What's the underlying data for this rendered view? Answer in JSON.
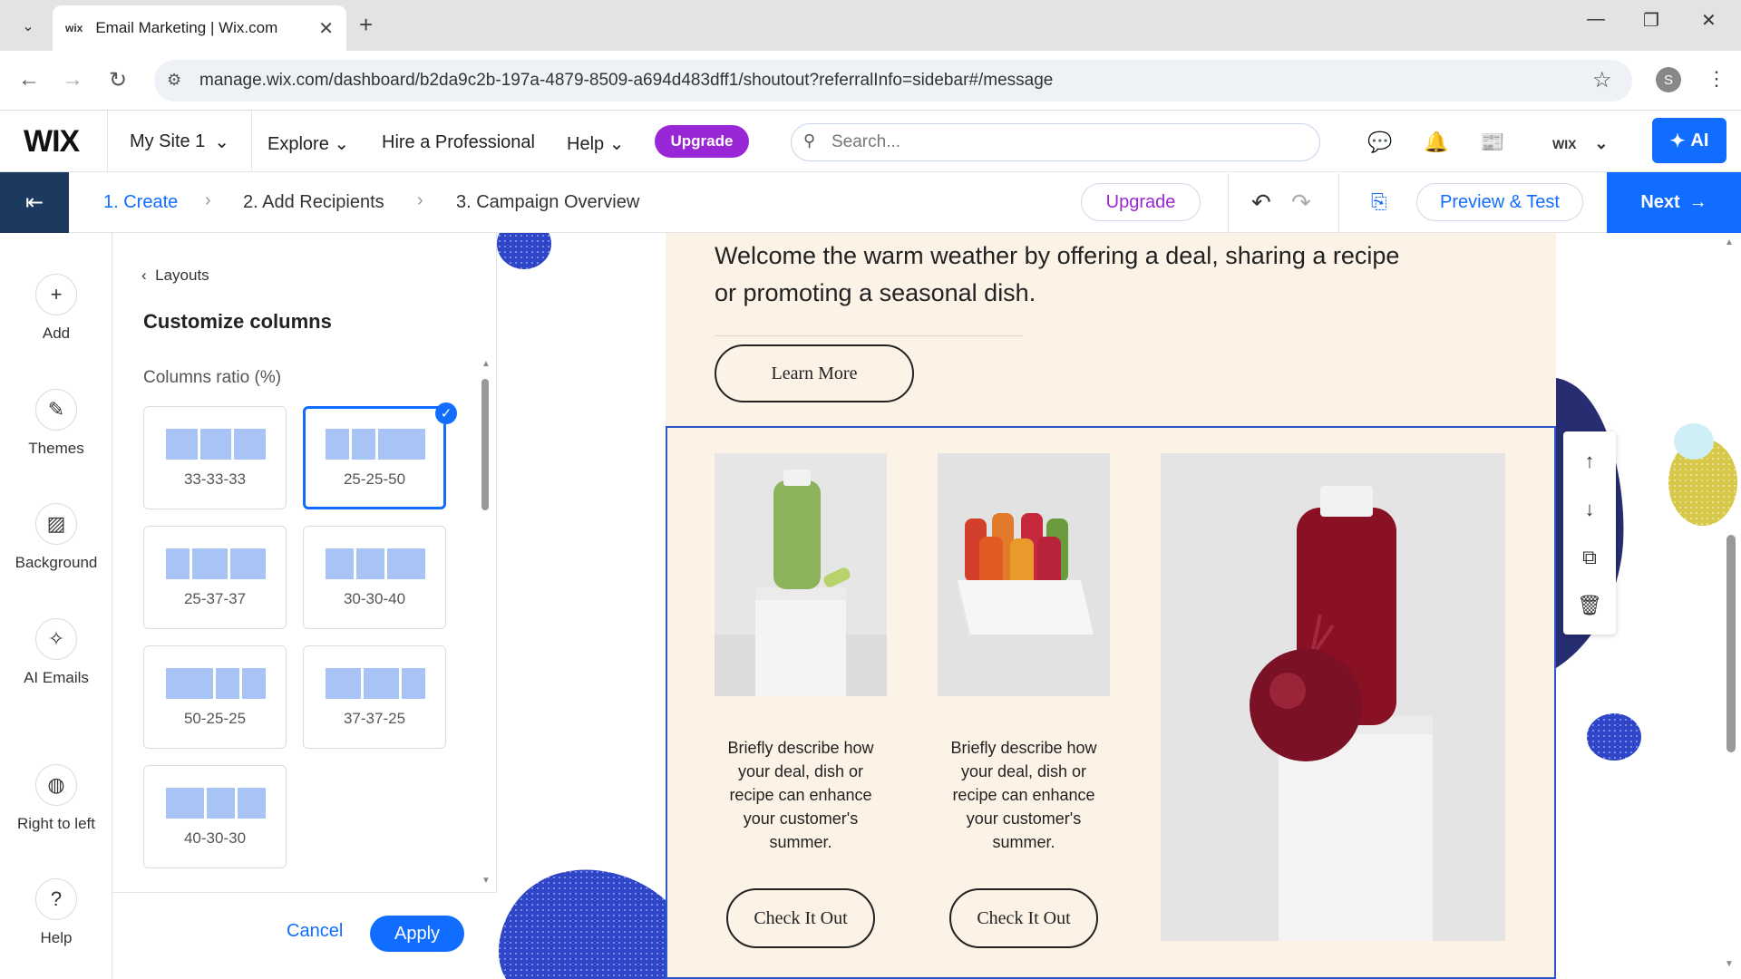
{
  "browser": {
    "tab_title": "Email Marketing | Wix.com",
    "favicon": "wix",
    "url": "manage.wix.com/dashboard/b2da9c2b-197a-4879-8509-a694d483dff1/shoutout?referralInfo=sidebar#/message",
    "profile_initial": "S"
  },
  "topbar": {
    "logo": "WIX",
    "site": "My Site 1",
    "nav": [
      "Explore",
      "Hire a Professional",
      "Help"
    ],
    "upgrade": "Upgrade",
    "search_placeholder": "Search...",
    "account_label": "WIX",
    "ai": "AI"
  },
  "wizard": {
    "steps": [
      "1. Create",
      "2. Add Recipients",
      "3. Campaign Overview"
    ],
    "upgrade": "Upgrade",
    "preview": "Preview & Test",
    "next": "Next"
  },
  "rail": [
    {
      "label": "Add",
      "icon": "plus-icon"
    },
    {
      "label": "Themes",
      "icon": "brush-icon"
    },
    {
      "label": "Background",
      "icon": "background-icon"
    },
    {
      "label": "AI Emails",
      "icon": "sparkle-icon"
    },
    {
      "label": "Right to left",
      "icon": "globe-icon"
    },
    {
      "label": "Help",
      "icon": "help-icon"
    }
  ],
  "panel": {
    "back": "Layouts",
    "title": "Customize columns",
    "ratio_label": "Columns ratio (%)",
    "options": [
      {
        "label": "33-33-33",
        "ratios": [
          33,
          33,
          33
        ],
        "selected": false
      },
      {
        "label": "25-25-50",
        "ratios": [
          25,
          25,
          50
        ],
        "selected": true
      },
      {
        "label": "25-37-37",
        "ratios": [
          25,
          37,
          37
        ],
        "selected": false
      },
      {
        "label": "30-30-40",
        "ratios": [
          30,
          30,
          40
        ],
        "selected": false
      },
      {
        "label": "50-25-25",
        "ratios": [
          50,
          25,
          25
        ],
        "selected": false
      },
      {
        "label": "37-37-25",
        "ratios": [
          37,
          37,
          25
        ],
        "selected": false
      },
      {
        "label": "40-30-30",
        "ratios": [
          40,
          30,
          30
        ],
        "selected": false
      }
    ],
    "cancel": "Cancel",
    "apply": "Apply"
  },
  "email": {
    "intro": "Welcome the warm weather by offering a deal, sharing a recipe or promoting a seasonal dish.",
    "learn_more": "Learn More",
    "col1_desc": "Briefly describe how your deal, dish or recipe can enhance your customer's summer.",
    "col2_desc": "Briefly describe how your deal, dish or recipe can enhance your customer's summer.",
    "cta1": "Check It Out",
    "cta2": "Check It Out"
  },
  "colors": {
    "wix_blue": "#116dff",
    "upgrade_purple": "#9a27d5",
    "email_bg": "#fdf2e6",
    "bar_fill": "#a8c4f6",
    "blob_blue": "#2f45c8"
  }
}
